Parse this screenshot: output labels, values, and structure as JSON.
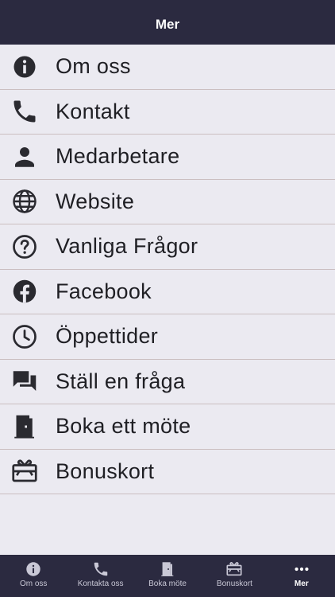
{
  "header": {
    "title": "Mer"
  },
  "menu": {
    "items": [
      {
        "label": "Om oss",
        "icon": "info-icon"
      },
      {
        "label": "Kontakt",
        "icon": "phone-icon"
      },
      {
        "label": "Medarbetare",
        "icon": "person-icon"
      },
      {
        "label": "Website",
        "icon": "globe-icon"
      },
      {
        "label": "Vanliga Frågor",
        "icon": "help-icon"
      },
      {
        "label": "Facebook",
        "icon": "facebook-icon"
      },
      {
        "label": "Öppettider",
        "icon": "clock-icon"
      },
      {
        "label": "Ställ en fråga",
        "icon": "chat-icon"
      },
      {
        "label": "Boka ett möte",
        "icon": "door-icon"
      },
      {
        "label": "Bonuskort",
        "icon": "gift-card-icon"
      }
    ]
  },
  "tabbar": {
    "tabs": [
      {
        "label": "Om oss",
        "icon": "info-icon"
      },
      {
        "label": "Kontakta oss",
        "icon": "phone-icon"
      },
      {
        "label": "Boka möte",
        "icon": "door-icon"
      },
      {
        "label": "Bonuskort",
        "icon": "gift-card-icon"
      },
      {
        "label": "Mer",
        "icon": "more-icon",
        "active": true
      }
    ]
  },
  "colors": {
    "bar_background": "#2b2a40",
    "page_background": "#ebeaf1",
    "divider": "#cbbfc1"
  }
}
